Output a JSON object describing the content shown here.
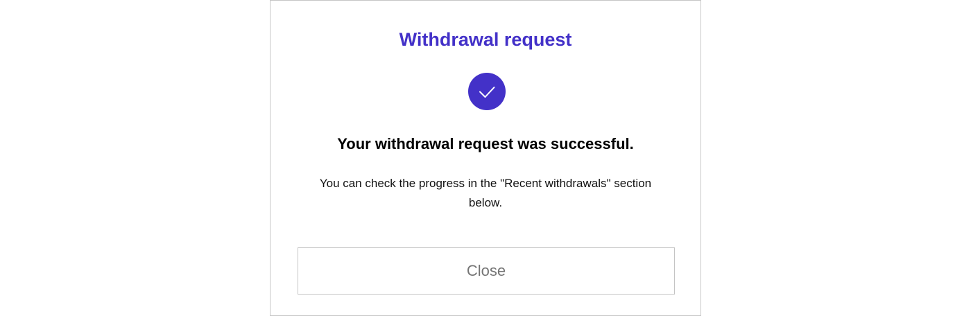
{
  "dialog": {
    "title": "Withdrawal request",
    "status_icon": "checkmark-icon",
    "headline": "Your withdrawal request was successful.",
    "body": "You can check the progress in the \"Recent withdrawals\" section below.",
    "close_label": "Close"
  },
  "colors": {
    "accent": "#4331c8",
    "headline_text": "#000000",
    "button_text": "#757575",
    "border": "#c6c6c6"
  }
}
